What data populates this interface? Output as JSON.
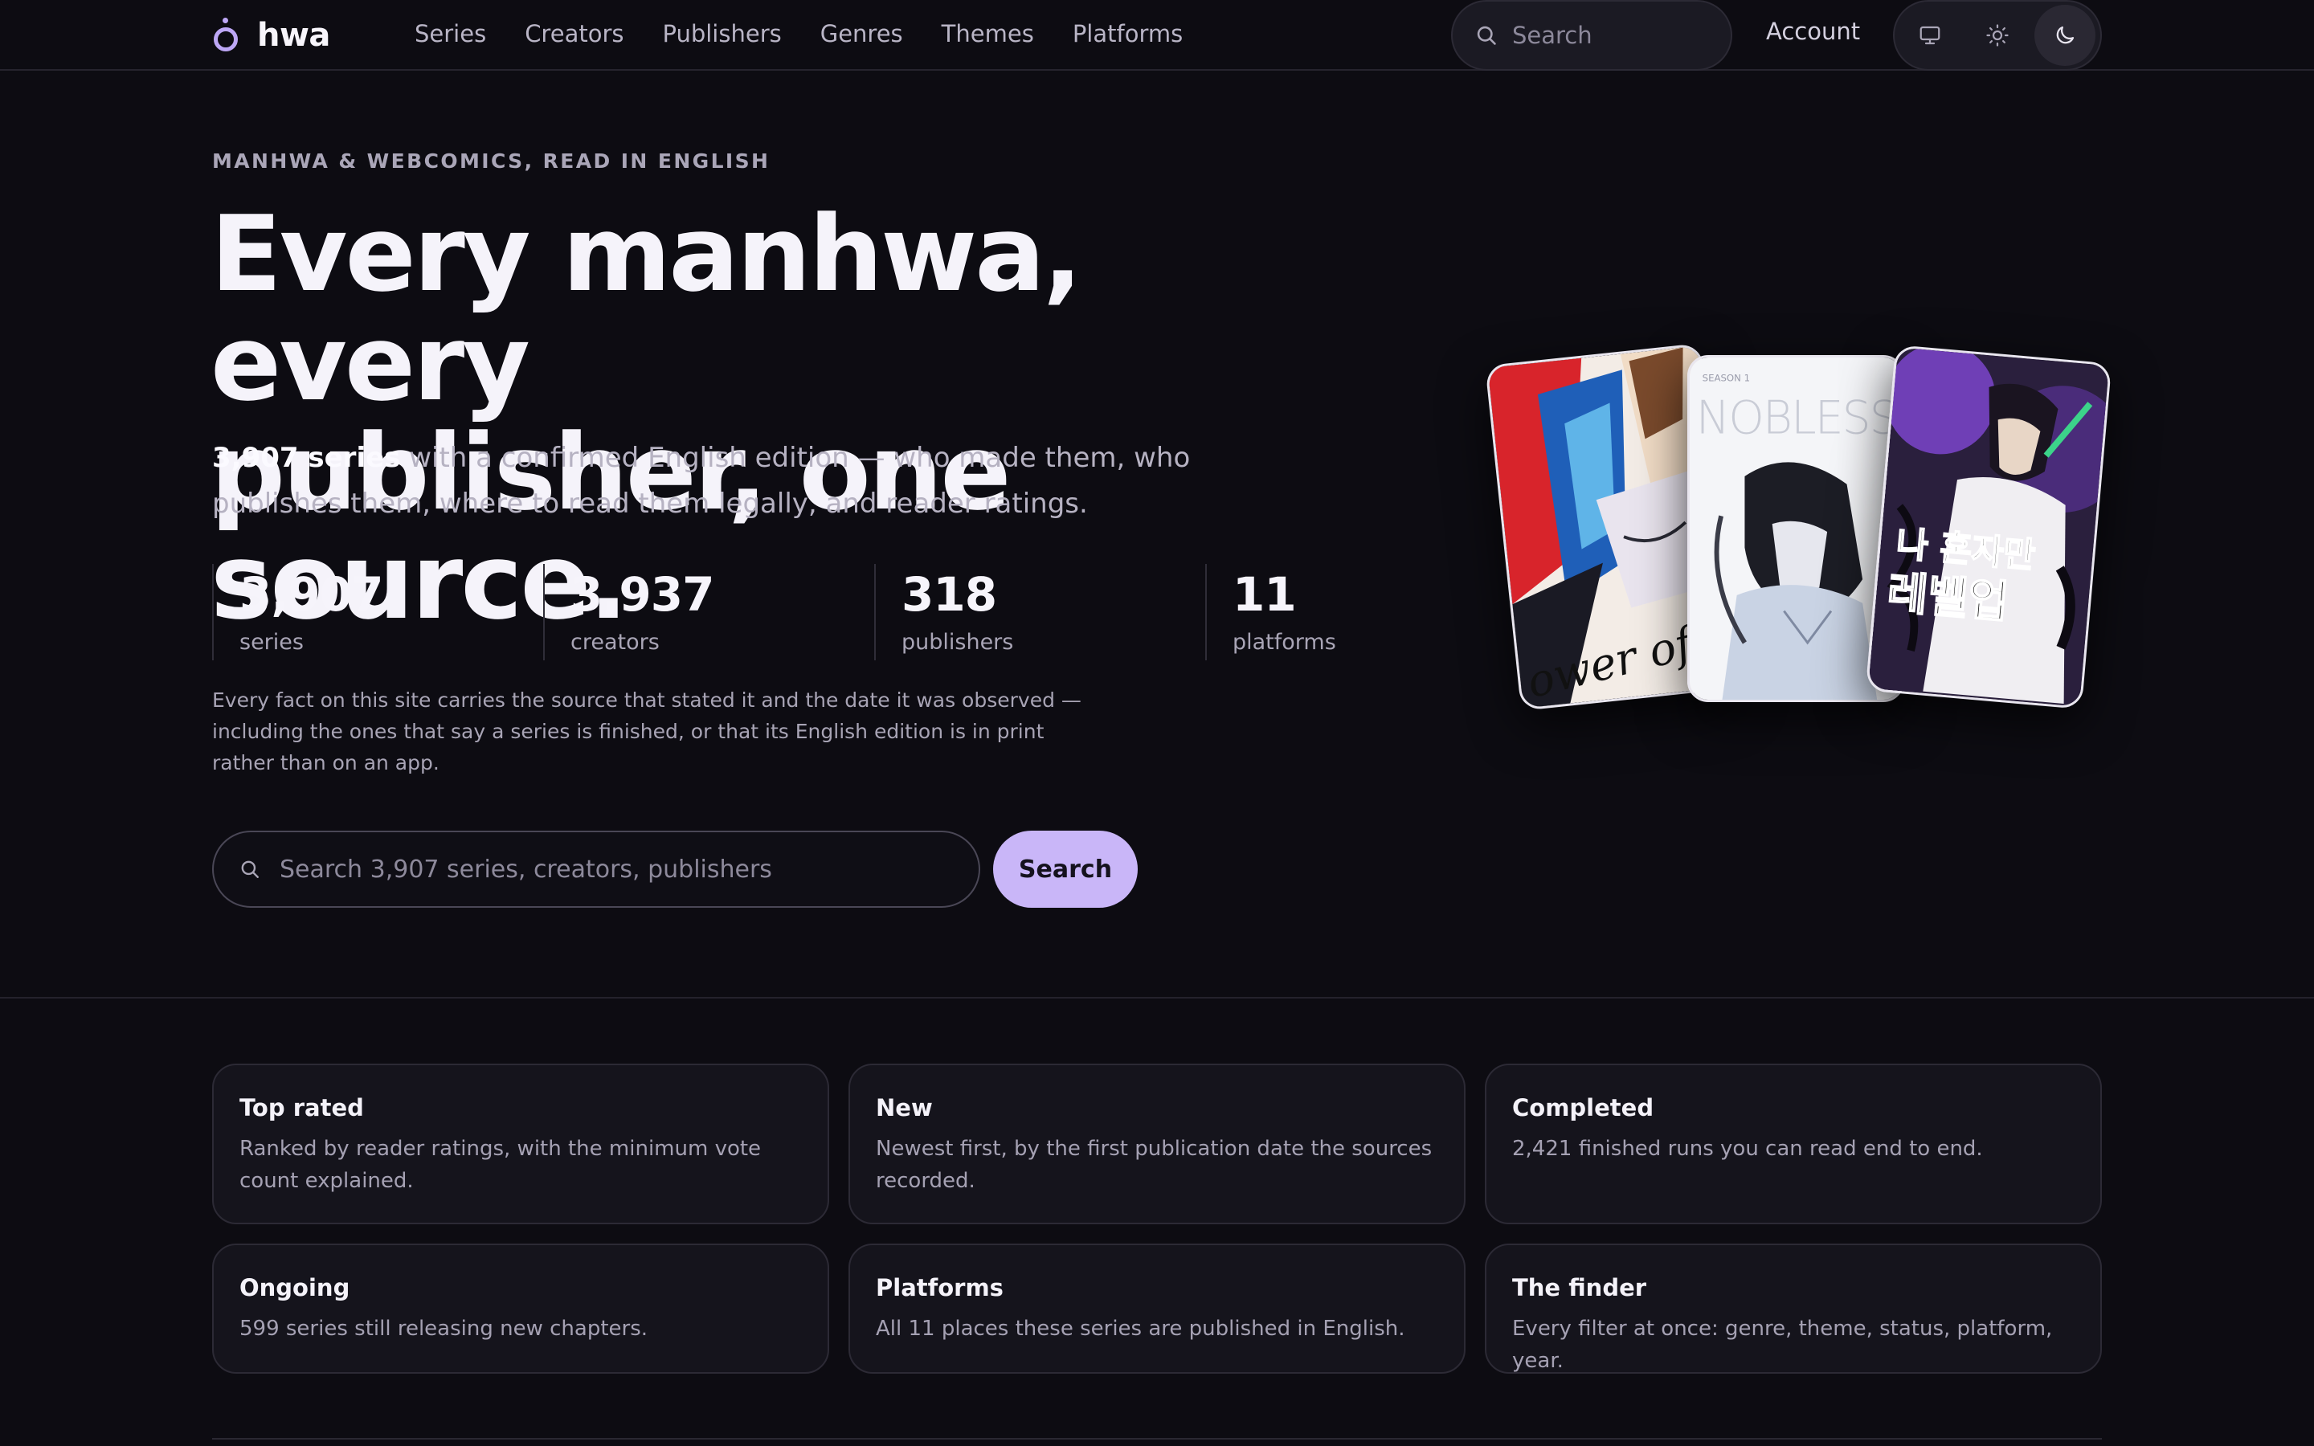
{
  "nav": {
    "brand": "hwa",
    "links": [
      "Series",
      "Creators",
      "Publishers",
      "Genres",
      "Themes",
      "Platforms"
    ],
    "search_placeholder": "Search",
    "account": "Account",
    "theme_options": [
      "system",
      "light",
      "dark"
    ],
    "theme_selected": "dark"
  },
  "hero": {
    "eyebrow": "MANHWA & WEBCOMICS, READ IN ENGLISH",
    "headline_line1": "Every manhwa, every",
    "headline_line2": "publisher, one source.",
    "lede_strong": "3,907 series",
    "lede_rest": " with a confirmed English edition — who made them, who publishes them, where to read them legally, and reader ratings.",
    "stats": [
      {
        "value": "3,907",
        "label": "series"
      },
      {
        "value": "3,937",
        "label": "creators"
      },
      {
        "value": "318",
        "label": "publishers"
      },
      {
        "value": "11",
        "label": "platforms"
      }
    ],
    "note": "Every fact on this site carries the source that stated it and the date it was observed — including the ones that say a series is finished, or that its English edition is in print rather than on an app.",
    "search_placeholder": "Search 3,907 series, creators, publishers",
    "search_button": "Search"
  },
  "covers": {
    "cover1_text": "ower of",
    "cover2_title": "NOBLESSE",
    "cover2_tag": "SEASON 1",
    "cover3_title_top": "나 혼자만",
    "cover3_title_bottom": "레벨업"
  },
  "cards": [
    {
      "title": "Top rated",
      "desc": "Ranked by reader ratings, with the minimum vote count explained."
    },
    {
      "title": "New",
      "desc": "Newest first, by the first publication date the sources recorded."
    },
    {
      "title": "Completed",
      "desc": "2,421 finished runs you can read end to end."
    },
    {
      "title": "Ongoing",
      "desc": "599 series still releasing new chapters."
    },
    {
      "title": "Platforms",
      "desc": "All 11 places these series are published in English."
    },
    {
      "title": "The finder",
      "desc": "Every filter at once: genre, theme, status, platform, year."
    }
  ],
  "colors": {
    "background": "#0d0c12",
    "accent": "#c9b6f8",
    "brand_mark": "#bda7f5"
  }
}
